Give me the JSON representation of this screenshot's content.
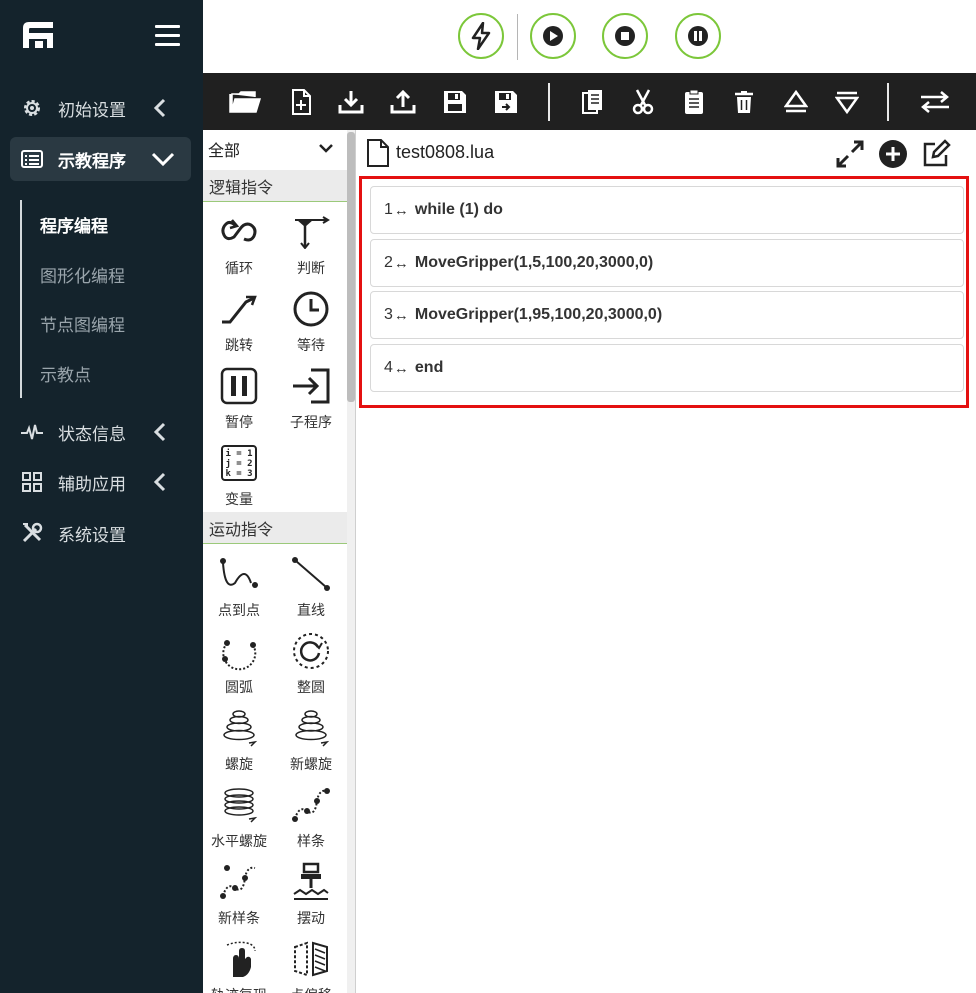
{
  "sidebar": {
    "nav": [
      {
        "label": "初始设置",
        "icon": "gear-icon"
      },
      {
        "label": "示教程序",
        "icon": "list-icon"
      },
      {
        "label": "状态信息",
        "icon": "pulse-icon"
      },
      {
        "label": "辅助应用",
        "icon": "grid-icon"
      },
      {
        "label": "系统设置",
        "icon": "tools-icon"
      }
    ],
    "subitems": [
      {
        "label": "程序编程"
      },
      {
        "label": "图形化编程"
      },
      {
        "label": "节点图编程"
      },
      {
        "label": "示教点"
      }
    ]
  },
  "controls": [
    "power-icon",
    "play-icon",
    "stop-icon",
    "pause-icon"
  ],
  "toolbar": [
    "open-folder-icon",
    "new-file-icon",
    "download-icon",
    "upload-icon",
    "save-icon",
    "save-as-icon",
    "copy-icon",
    "cut-icon",
    "paste-icon",
    "delete-icon",
    "move-up-icon",
    "move-down-icon",
    "swap-icon"
  ],
  "palette": {
    "filter": "全部",
    "categories": [
      {
        "label": "逻辑指令"
      },
      {
        "label": "运动指令"
      }
    ],
    "logic_items": [
      {
        "label": "循环",
        "icon": "loop-icon"
      },
      {
        "label": "判断",
        "icon": "branch-icon"
      },
      {
        "label": "跳转",
        "icon": "jump-icon"
      },
      {
        "label": "等待",
        "icon": "clock-icon"
      },
      {
        "label": "暂停",
        "icon": "pause-box-icon"
      },
      {
        "label": "子程序",
        "icon": "subprogram-icon"
      },
      {
        "label": "变量",
        "icon": "variable-icon",
        "icon_text": [
          "i = 1",
          "j = 2",
          "k = 3"
        ]
      }
    ],
    "motion_items": [
      {
        "label": "点到点",
        "icon": "ptp-icon"
      },
      {
        "label": "直线",
        "icon": "line-icon"
      },
      {
        "label": "圆弧",
        "icon": "arc-icon"
      },
      {
        "label": "整圆",
        "icon": "circle-icon"
      },
      {
        "label": "螺旋",
        "icon": "spiral-icon"
      },
      {
        "label": "新螺旋",
        "icon": "new-spiral-icon"
      },
      {
        "label": "水平螺旋",
        "icon": "horizontal-spiral-icon"
      },
      {
        "label": "样条",
        "icon": "spline-icon"
      },
      {
        "label": "新样条",
        "icon": "new-spline-icon"
      },
      {
        "label": "摆动",
        "icon": "weave-icon"
      },
      {
        "label": "轨迹复现",
        "icon": "trajectory-icon"
      },
      {
        "label": "点偏移",
        "icon": "offset-icon"
      }
    ]
  },
  "editor": {
    "filename": "test0808.lua",
    "lines": [
      {
        "num": "1",
        "arrow": "↔",
        "code": "while (1) do"
      },
      {
        "num": "2",
        "arrow": "↔",
        "code": "MoveGripper(1,5,100,20,3000,0)"
      },
      {
        "num": "3",
        "arrow": "↔",
        "code": "MoveGripper(1,95,100,20,3000,0)"
      },
      {
        "num": "4",
        "arrow": "↔",
        "code": "end"
      }
    ]
  },
  "colors": {
    "sidebar_bg": "#14232c",
    "toolbar_bg": "#202020",
    "control_ring": "#7cc73a",
    "highlight_border": "#e41010"
  }
}
